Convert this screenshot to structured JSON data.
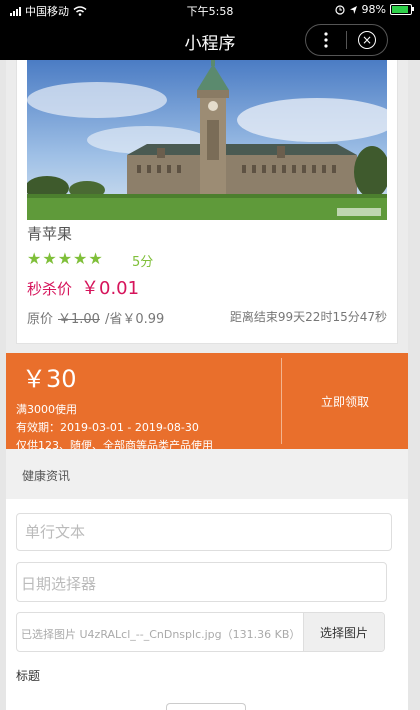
{
  "status_bar": {
    "carrier": "中国移动",
    "time": "下午5:58",
    "battery": "98%"
  },
  "nav": {
    "title": "小程序"
  },
  "product": {
    "name": "青苹果",
    "stars": "★★★★★",
    "score": "5分",
    "flash_label": "秒杀价",
    "flash_price": "￥0.01",
    "original_label": "原价",
    "original_price": "￥1.00",
    "save_text": "/省￥0.99",
    "countdown": "距离结束99天22时15分47秒"
  },
  "coupon": {
    "amount": "￥30",
    "condition": "满3000使用",
    "validity": "有效期：2019-03-01 - 2019-08-30",
    "scope": "仅供123、随便、全部商等品类产品使用",
    "claim_label": "立即领取"
  },
  "section": {
    "title": "健康资讯"
  },
  "form": {
    "text_placeholder": "单行文本",
    "date_placeholder": "日期选择器",
    "file_name": "已选择图片 U4zRALcl_--_CnDnsplc.jpg（131.36 KB）",
    "choose_label": "选择图片",
    "title_label": "标题"
  },
  "colors": {
    "accent_green": "#7fbf39",
    "price_red": "#d6145b",
    "coupon_orange": "#e96f2c"
  }
}
